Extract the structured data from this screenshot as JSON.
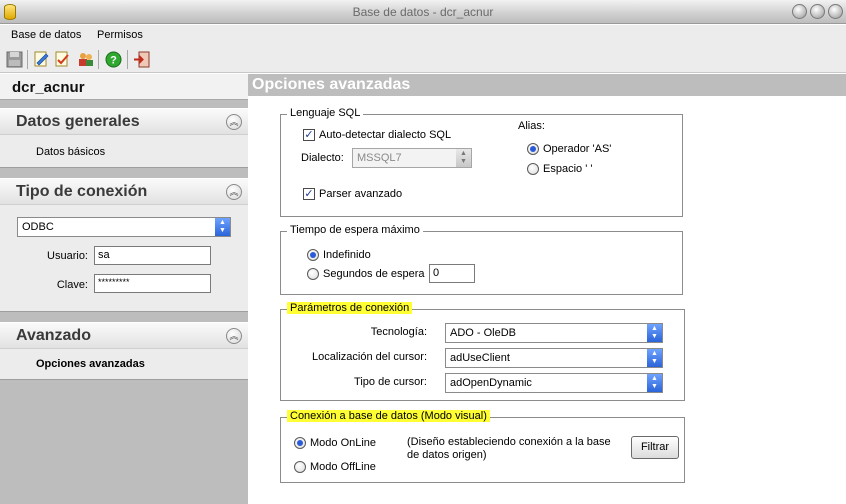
{
  "window": {
    "title": "Base de datos - dcr_acnur"
  },
  "menu": {
    "items": [
      "Base de datos",
      "Permisos"
    ]
  },
  "toolbar": {
    "icons": [
      "save-icon",
      "edit-icon",
      "validate-icon",
      "users-icon",
      "help-icon",
      "exit-icon"
    ]
  },
  "sidebar": {
    "db_name": "dcr_acnur",
    "general": {
      "title": "Datos generales",
      "link": "Datos básicos"
    },
    "connection": {
      "title": "Tipo de conexión",
      "type": "ODBC",
      "user_label": "Usuario:",
      "user_value": "sa",
      "password_label": "Clave:",
      "password_value": "*********"
    },
    "advanced": {
      "title": "Avanzado",
      "link": "Opciones avanzadas"
    }
  },
  "main": {
    "title": "Opciones avanzadas",
    "sql": {
      "legend": "Lenguaje SQL",
      "autodetect_label": "Auto-detectar dialecto SQL",
      "autodetect_checked": true,
      "dialect_label": "Dialecto:",
      "dialect_value": "MSSQL7",
      "parser_label": "Parser avanzado",
      "parser_checked": true,
      "alias_label": "Alias:",
      "alias_options": [
        "Operador 'AS'",
        "Espacio ' '"
      ],
      "alias_selected": 0
    },
    "timeout": {
      "legend": "Tiempo de espera máximo",
      "options": [
        "Indefinido",
        "Segundos de espera"
      ],
      "selected": 0,
      "seconds_value": "0"
    },
    "params": {
      "legend": "Parámetros de conexión",
      "technology_label": "Tecnología:",
      "technology_value": "ADO - OleDB",
      "cursor_location_label": "Localización del cursor:",
      "cursor_location_value": "adUseClient",
      "cursor_type_label": "Tipo de cursor:",
      "cursor_type_value": "adOpenDynamic"
    },
    "visual": {
      "legend": "Conexión a base de datos (Modo visual)",
      "options": [
        "Modo OnLine",
        "Modo OffLine"
      ],
      "selected": 0,
      "description_line1": "(Diseño estableciendo conexión a la base",
      "description_line2": "de datos origen)",
      "filter_button": "Filtrar"
    }
  }
}
